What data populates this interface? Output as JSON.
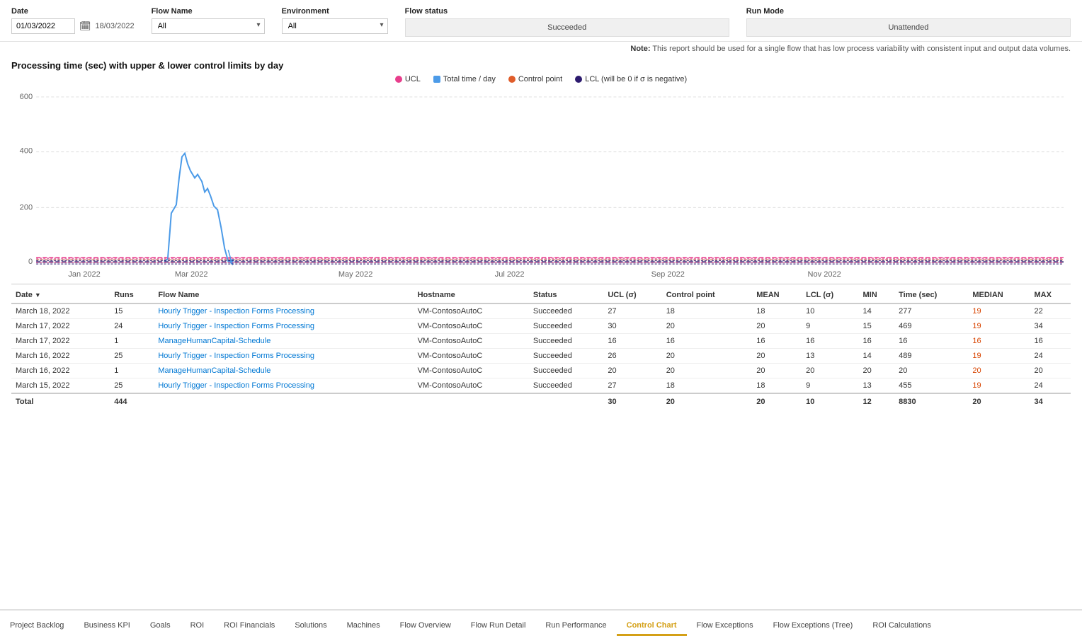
{
  "filters": {
    "date_label": "Date",
    "date_from": "01/03/2022",
    "date_to": "18/03/2022",
    "flow_name_label": "Flow Name",
    "flow_name_value": "All",
    "environment_label": "Environment",
    "environment_value": "All",
    "flow_status_label": "Flow status",
    "flow_status_value": "Succeeded",
    "run_mode_label": "Run Mode",
    "run_mode_value": "Unattended"
  },
  "note": {
    "prefix": "Note:",
    "text": " This report should be used for a single flow that has low process variability with consistent input and output data volumes."
  },
  "chart": {
    "title": "Processing time (sec) with upper & lower control limits by day",
    "legend": [
      {
        "key": "ucl",
        "label": "UCL",
        "color": "#e83e8c"
      },
      {
        "key": "total_time",
        "label": "Total time / day",
        "color": "#4c9be8"
      },
      {
        "key": "control_point",
        "label": "Control point",
        "color": "#e05d2a"
      },
      {
        "key": "lcl",
        "label": "LCL (will be 0 if σ is negative)",
        "color": "#2c1a6e"
      }
    ],
    "y_labels": [
      "600",
      "400",
      "200",
      "0"
    ],
    "x_labels": [
      "Jan 2022",
      "Mar 2022",
      "May 2022",
      "Jul 2022",
      "Sep 2022",
      "Nov 2022"
    ]
  },
  "table": {
    "columns": [
      "Date",
      "Runs",
      "Flow Name",
      "Hostname",
      "Status",
      "UCL (σ)",
      "Control point",
      "MEAN",
      "LCL (σ)",
      "MIN",
      "Time (sec)",
      "MEDIAN",
      "MAX"
    ],
    "rows": [
      {
        "date": "March 18, 2022",
        "runs": "15",
        "flow_name": "Hourly Trigger - Inspection Forms Processing",
        "hostname": "VM-ContosoAutoC",
        "status": "Succeeded",
        "ucl": "27",
        "control_point": "18",
        "mean": "18",
        "lcl": "10",
        "min": "14",
        "time": "277",
        "median": "19",
        "max": "22"
      },
      {
        "date": "March 17, 2022",
        "runs": "24",
        "flow_name": "Hourly Trigger - Inspection Forms Processing",
        "hostname": "VM-ContosoAutoC",
        "status": "Succeeded",
        "ucl": "30",
        "control_point": "20",
        "mean": "20",
        "lcl": "9",
        "min": "15",
        "time": "469",
        "median": "19",
        "max": "34"
      },
      {
        "date": "March 17, 2022",
        "runs": "1",
        "flow_name": "ManageHumanCapital-Schedule",
        "hostname": "VM-ContosoAutoC",
        "status": "Succeeded",
        "ucl": "16",
        "control_point": "16",
        "mean": "16",
        "lcl": "16",
        "min": "16",
        "time": "16",
        "median": "16",
        "max": "16"
      },
      {
        "date": "March 16, 2022",
        "runs": "25",
        "flow_name": "Hourly Trigger - Inspection Forms Processing",
        "hostname": "VM-ContosoAutoC",
        "status": "Succeeded",
        "ucl": "26",
        "control_point": "20",
        "mean": "20",
        "lcl": "13",
        "min": "14",
        "time": "489",
        "median": "19",
        "max": "24"
      },
      {
        "date": "March 16, 2022",
        "runs": "1",
        "flow_name": "ManageHumanCapital-Schedule",
        "hostname": "VM-ContosoAutoC",
        "status": "Succeeded",
        "ucl": "20",
        "control_point": "20",
        "mean": "20",
        "lcl": "20",
        "min": "20",
        "time": "20",
        "median": "20",
        "max": "20"
      },
      {
        "date": "March 15, 2022",
        "runs": "25",
        "flow_name": "Hourly Trigger - Inspection Forms Processing",
        "hostname": "VM-ContosoAutoC",
        "status": "Succeeded",
        "ucl": "27",
        "control_point": "18",
        "mean": "18",
        "lcl": "9",
        "min": "13",
        "time": "455",
        "median": "19",
        "max": "24"
      }
    ],
    "footer": {
      "label": "Total",
      "runs": "444",
      "ucl": "30",
      "control_point": "20",
      "mean": "20",
      "lcl": "10",
      "min": "12",
      "time": "8830",
      "median": "20",
      "max": "34"
    }
  },
  "tabs": [
    {
      "key": "project-backlog",
      "label": "Project Backlog",
      "active": false
    },
    {
      "key": "business-kpi",
      "label": "Business KPI",
      "active": false
    },
    {
      "key": "goals",
      "label": "Goals",
      "active": false
    },
    {
      "key": "roi",
      "label": "ROI",
      "active": false
    },
    {
      "key": "roi-financials",
      "label": "ROI Financials",
      "active": false
    },
    {
      "key": "solutions",
      "label": "Solutions",
      "active": false
    },
    {
      "key": "machines",
      "label": "Machines",
      "active": false
    },
    {
      "key": "flow-overview",
      "label": "Flow Overview",
      "active": false
    },
    {
      "key": "flow-run-detail",
      "label": "Flow Run Detail",
      "active": false
    },
    {
      "key": "run-performance",
      "label": "Run Performance",
      "active": false
    },
    {
      "key": "control-chart",
      "label": "Control Chart",
      "active": true
    },
    {
      "key": "flow-exceptions",
      "label": "Flow Exceptions",
      "active": false
    },
    {
      "key": "flow-exceptions-tree",
      "label": "Flow Exceptions (Tree)",
      "active": false
    },
    {
      "key": "roi-calculations",
      "label": "ROI Calculations",
      "active": false
    }
  ]
}
